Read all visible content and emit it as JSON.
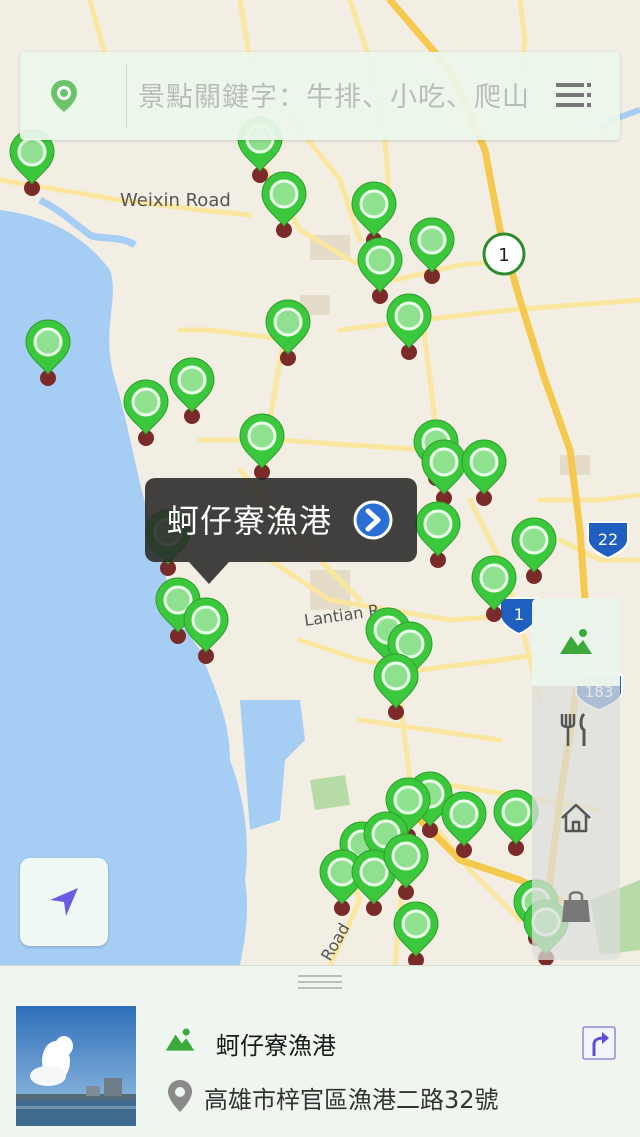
{
  "map": {
    "roads": {
      "weixin_road": "Weixin Road",
      "lantian_road": "Lantian R",
      "road_bottom": "Road"
    },
    "shields": [
      {
        "label": "1",
        "kind": "provincial"
      },
      {
        "label": "22",
        "kind": "national"
      },
      {
        "label": "1",
        "kind": "national"
      },
      {
        "label": "183",
        "kind": "national"
      }
    ],
    "colors": {
      "sea": "#a6cdf3",
      "land": "#f3eee3",
      "highway": "#f5c94e",
      "road": "#fbe6a0",
      "pin_green": "#3cc83c",
      "pin_base": "#7b2a2a"
    }
  },
  "search": {
    "placeholder": "景點關鍵字：牛排、小吃、爬山",
    "value": ""
  },
  "callout": {
    "title": "蚵仔寮漁港"
  },
  "categories": [
    {
      "icon": "mountain-icon",
      "active": true
    },
    {
      "icon": "fork-knife-icon",
      "active": false
    },
    {
      "icon": "house-icon",
      "active": false
    },
    {
      "icon": "shopping-bag-icon",
      "active": false
    }
  ],
  "detail": {
    "name": "蚵仔寮漁港",
    "address": "高雄市梓官區漁港二路32號",
    "category_icon": "mountain-icon"
  }
}
